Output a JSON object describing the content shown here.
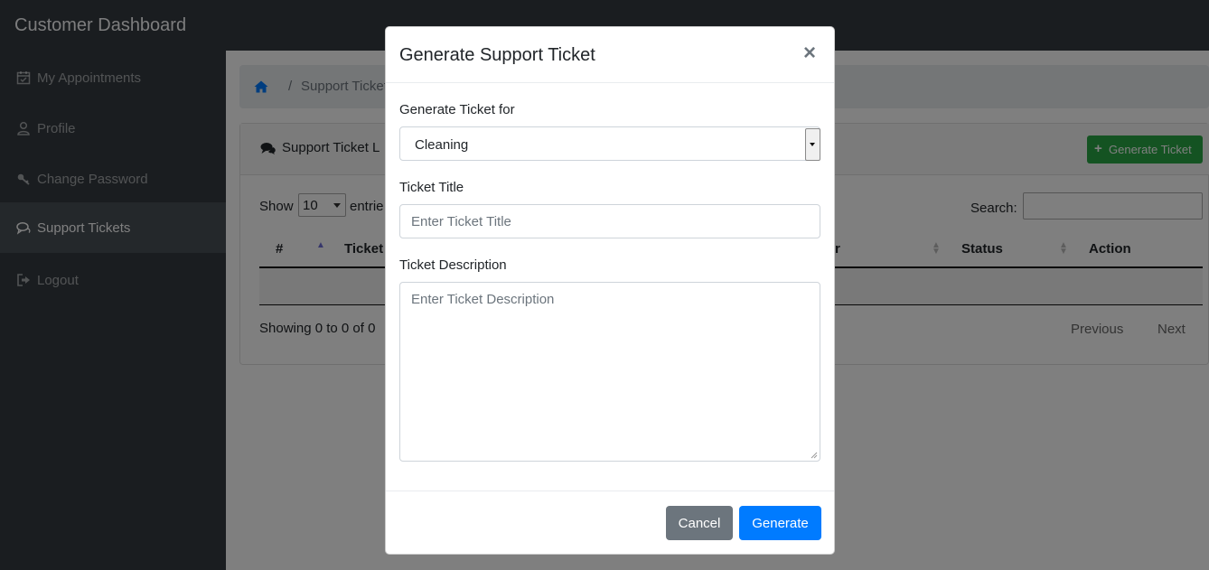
{
  "app": {
    "title": "Customer Dashboard"
  },
  "sidebar": {
    "items": [
      {
        "label": "My Appointments",
        "icon": "calendar-check-icon",
        "active": false
      },
      {
        "label": "Profile",
        "icon": "user-icon",
        "active": false
      },
      {
        "label": "Change Password",
        "icon": "key-icon",
        "active": false
      },
      {
        "label": "Support Tickets",
        "icon": "comments-icon",
        "active": true
      },
      {
        "label": "Logout",
        "icon": "sign-out-icon",
        "active": false
      }
    ]
  },
  "breadcrumb": {
    "separator": "/",
    "current": "Support Tickets"
  },
  "card": {
    "title": "Support Ticket L",
    "generate_button": "Generate Ticket",
    "generate_plus": "+"
  },
  "table": {
    "show_label": "Show",
    "page_length": "10",
    "entries_label": "entrie",
    "search_label": "Search:",
    "columns": [
      "#",
      "Ticket",
      "r",
      "Status",
      "Action"
    ],
    "showing_text": "Showing 0 to 0 of 0",
    "previous": "Previous",
    "next": "Next"
  },
  "modal": {
    "title": "Generate Support Ticket",
    "close": "×",
    "ticket_for_label": "Generate Ticket for",
    "ticket_for_value": "Cleaning",
    "title_label": "Ticket Title",
    "title_placeholder": "Enter Ticket Title",
    "description_label": "Ticket Description",
    "description_placeholder": "Enter Ticket Description",
    "cancel_button": "Cancel",
    "generate_button": "Generate"
  },
  "colors": {
    "sidebar_bg": "#343a40",
    "active_item_bg": "#495057",
    "primary": "#007bff",
    "success": "#28a745",
    "secondary": "#6c757d"
  }
}
